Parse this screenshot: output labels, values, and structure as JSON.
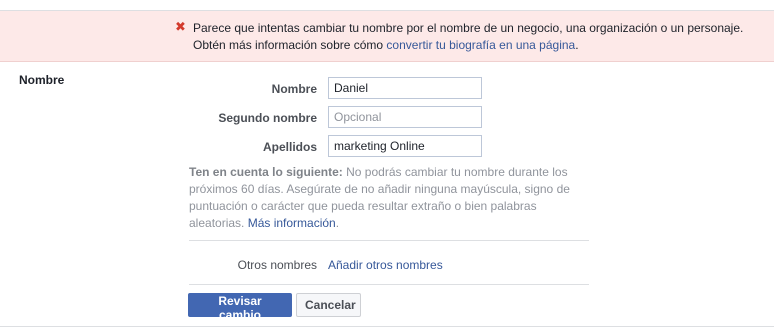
{
  "error": {
    "line1": "Parece que intentas cambiar tu nombre por el nombre de un negocio, una organización o un personaje.",
    "line2_prefix": "Obtén más información sobre cómo ",
    "line2_link": "convertir tu biografía en una página",
    "line2_suffix": ".",
    "icon": "close-x-icon",
    "icon_color": "#d33a2c"
  },
  "section": {
    "title": "Nombre"
  },
  "fields": {
    "first_name": {
      "label": "Nombre",
      "value": "Daniel"
    },
    "middle_name": {
      "label": "Segundo nombre",
      "placeholder": "Opcional"
    },
    "last_name": {
      "label": "Apellidos",
      "value": "marketing Online"
    }
  },
  "note": {
    "bold": "Ten en cuenta lo siguiente:",
    "text": " No podrás cambiar tu nombre durante los próximos 60 días. Asegúrate de no añadir ninguna mayúscula, signo de puntuación o carácter que pueda resultar extraño o bien palabras aleatorias. ",
    "link": "Más información",
    "suffix": "."
  },
  "other_names": {
    "label": "Otros nombres",
    "link": "Añadir otros nombres"
  },
  "buttons": {
    "review": "Revisar cambio",
    "cancel": "Cancelar"
  },
  "colors": {
    "accent": "#4267b2",
    "link": "#365899",
    "banner_bg": "#fde9e8"
  }
}
